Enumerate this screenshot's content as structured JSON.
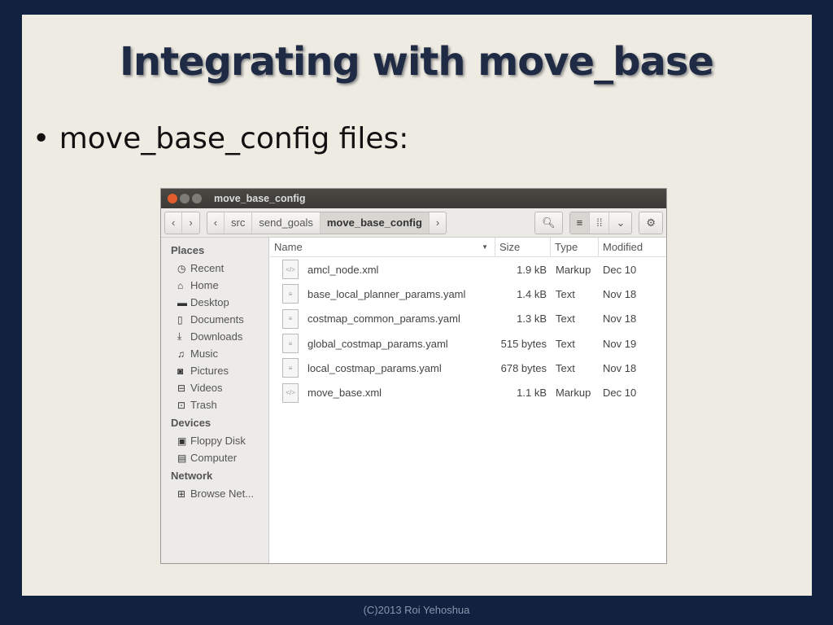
{
  "slide": {
    "title": "Integrating with move_base",
    "bullet": "move_base_config files:",
    "footer": "(C)2013 Roi Yehoshua"
  },
  "window": {
    "title": "move_base_config",
    "path": [
      "src",
      "send_goals",
      "move_base_config"
    ],
    "columns": [
      "Name",
      "Size",
      "Type",
      "Modified"
    ],
    "places_header": "Places",
    "devices_header": "Devices",
    "network_header": "Network",
    "places": [
      {
        "label": "Recent",
        "icon": "◷"
      },
      {
        "label": "Home",
        "icon": "⌂"
      },
      {
        "label": "Desktop",
        "icon": "▬"
      },
      {
        "label": "Documents",
        "icon": "▯"
      },
      {
        "label": "Downloads",
        "icon": "⤓"
      },
      {
        "label": "Music",
        "icon": "♫"
      },
      {
        "label": "Pictures",
        "icon": "◙"
      },
      {
        "label": "Videos",
        "icon": "⊟"
      },
      {
        "label": "Trash",
        "icon": "⊡"
      }
    ],
    "devices": [
      {
        "label": "Floppy Disk",
        "icon": "▣"
      },
      {
        "label": "Computer",
        "icon": "▤"
      }
    ],
    "network": [
      {
        "label": "Browse Net...",
        "icon": "⊞"
      }
    ],
    "files": [
      {
        "name": "amcl_node.xml",
        "size": "1.9 kB",
        "type": "Markup",
        "modified": "Dec 10"
      },
      {
        "name": "base_local_planner_params.yaml",
        "size": "1.4 kB",
        "type": "Text",
        "modified": "Nov 18"
      },
      {
        "name": "costmap_common_params.yaml",
        "size": "1.3 kB",
        "type": "Text",
        "modified": "Nov 18"
      },
      {
        "name": "global_costmap_params.yaml",
        "size": "515 bytes",
        "type": "Text",
        "modified": "Nov 19"
      },
      {
        "name": "local_costmap_params.yaml",
        "size": "678 bytes",
        "type": "Text",
        "modified": "Nov 18"
      },
      {
        "name": "move_base.xml",
        "size": "1.1 kB",
        "type": "Markup",
        "modified": "Dec 10"
      }
    ]
  }
}
